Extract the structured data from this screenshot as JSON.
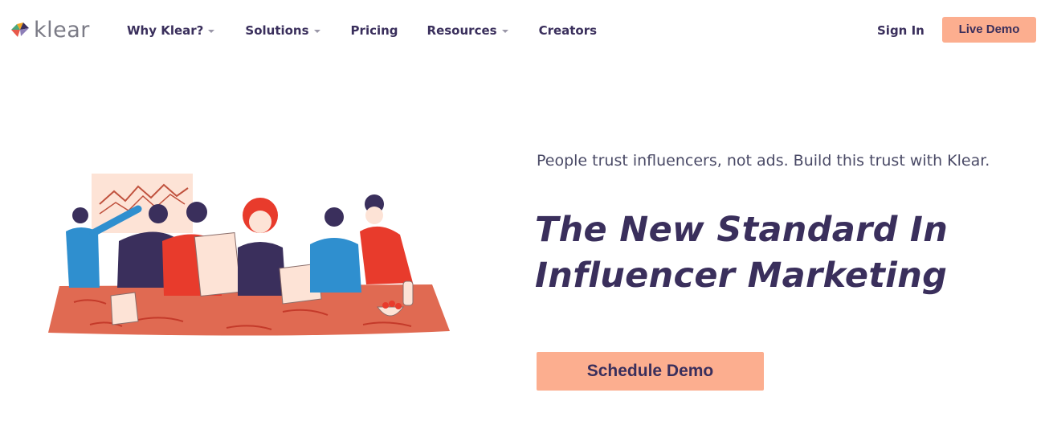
{
  "brand": {
    "name": "klear",
    "logo_colors": [
      "#e8584a",
      "#4aa87c",
      "#f5a623",
      "#3a2f5c"
    ]
  },
  "nav": {
    "items": [
      {
        "label": "Why Klear?",
        "dropdown": true
      },
      {
        "label": "Solutions",
        "dropdown": true
      },
      {
        "label": "Pricing",
        "dropdown": false
      },
      {
        "label": "Resources",
        "dropdown": true
      },
      {
        "label": "Creators",
        "dropdown": false
      }
    ],
    "sign_in": "Sign In",
    "live_demo": "Live Demo"
  },
  "hero": {
    "tagline": "People trust influencers, not ads. Build this trust with Klear.",
    "headline_line1": "The New Standard In",
    "headline_line2": "Influencer Marketing",
    "cta": "Schedule Demo",
    "illustration": "team-meeting-illustration"
  },
  "colors": {
    "accent": "#fcae8f",
    "text_dark": "#3a2f5c",
    "table_red": "#e06a52"
  }
}
